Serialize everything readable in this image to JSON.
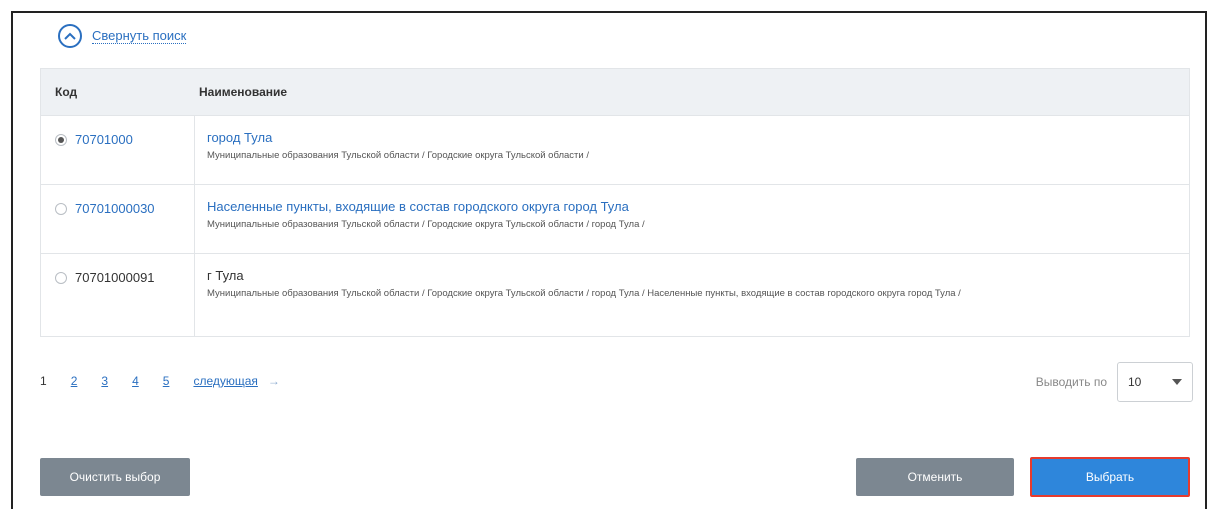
{
  "collapse": {
    "label": "Свернуть поиск",
    "icon": "chevron-up-circle-icon"
  },
  "table": {
    "headers": {
      "code": "Код",
      "name": "Наименование"
    },
    "rows": [
      {
        "code": "70701000",
        "title": "город Тула",
        "path": "Муниципальные образования Тульской области / Городские округа Тульской области /",
        "selected": true
      },
      {
        "code": "70701000030",
        "title": "Населенные пункты, входящие в состав городского округа город Тула",
        "path": "Муниципальные образования Тульской области / Городские округа Тульской области / город Тула /",
        "selected": false
      },
      {
        "code": "70701000091",
        "title": "г Тула",
        "path": "Муниципальные образования Тульской области / Городские округа Тульской области / город Тула / Населенные пункты, входящие в состав городского округа город Тула /",
        "selected": false
      }
    ]
  },
  "pagination": {
    "current": "1",
    "pages": [
      "2",
      "3",
      "4",
      "5"
    ],
    "next": "следующая",
    "next_arrow": "→"
  },
  "per_page": {
    "label": "Выводить по",
    "value": "10"
  },
  "buttons": {
    "clear": "Очистить выбор",
    "cancel": "Отменить",
    "select": "Выбрать"
  },
  "colors": {
    "link": "#2a6fc0",
    "primary": "#2e86db",
    "secondary": "#7c8791",
    "focus": "#e63b2e"
  }
}
